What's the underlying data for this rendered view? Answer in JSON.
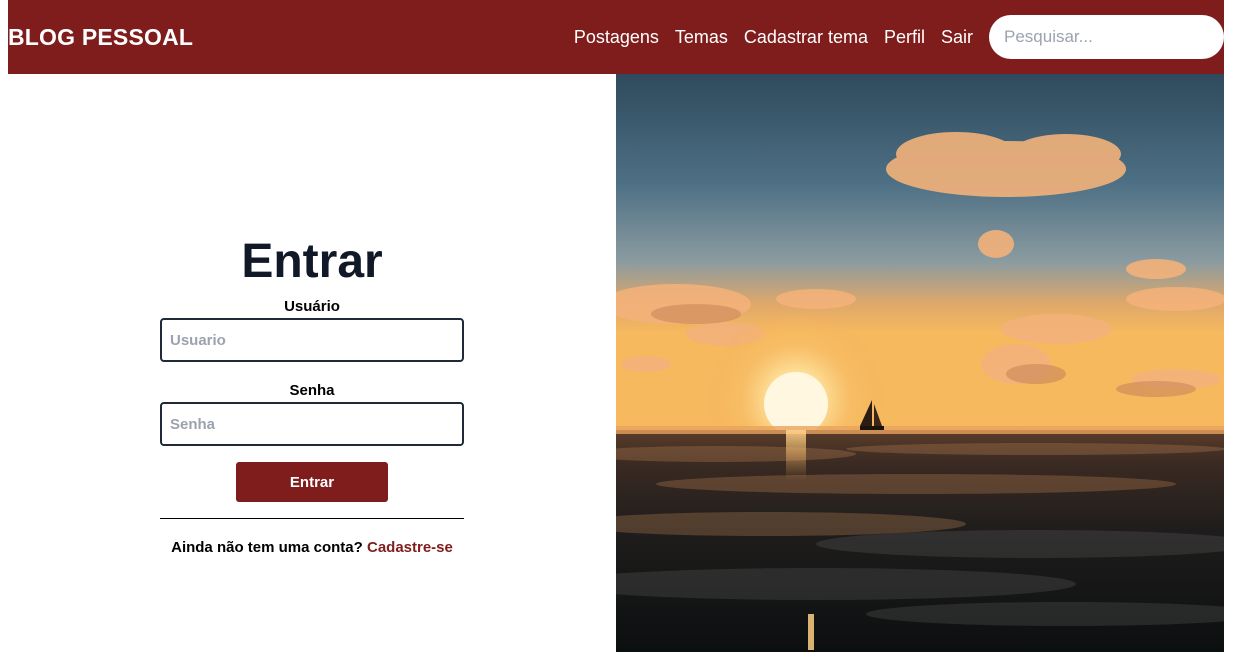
{
  "navbar": {
    "brand": "BLOG PESSOAL",
    "links": [
      "Postagens",
      "Temas",
      "Cadastrar tema",
      "Perfil",
      "Sair"
    ],
    "search_placeholder": "Pesquisar..."
  },
  "login": {
    "title": "Entrar",
    "user_label": "Usuário",
    "user_placeholder": "Usuario",
    "password_label": "Senha",
    "password_placeholder": "Senha",
    "submit_label": "Entrar",
    "signup_prompt": "Ainda não tem uma conta?",
    "signup_link": "Cadastre-se"
  },
  "colors": {
    "brand": "#7f1d1d",
    "title": "#111827"
  }
}
